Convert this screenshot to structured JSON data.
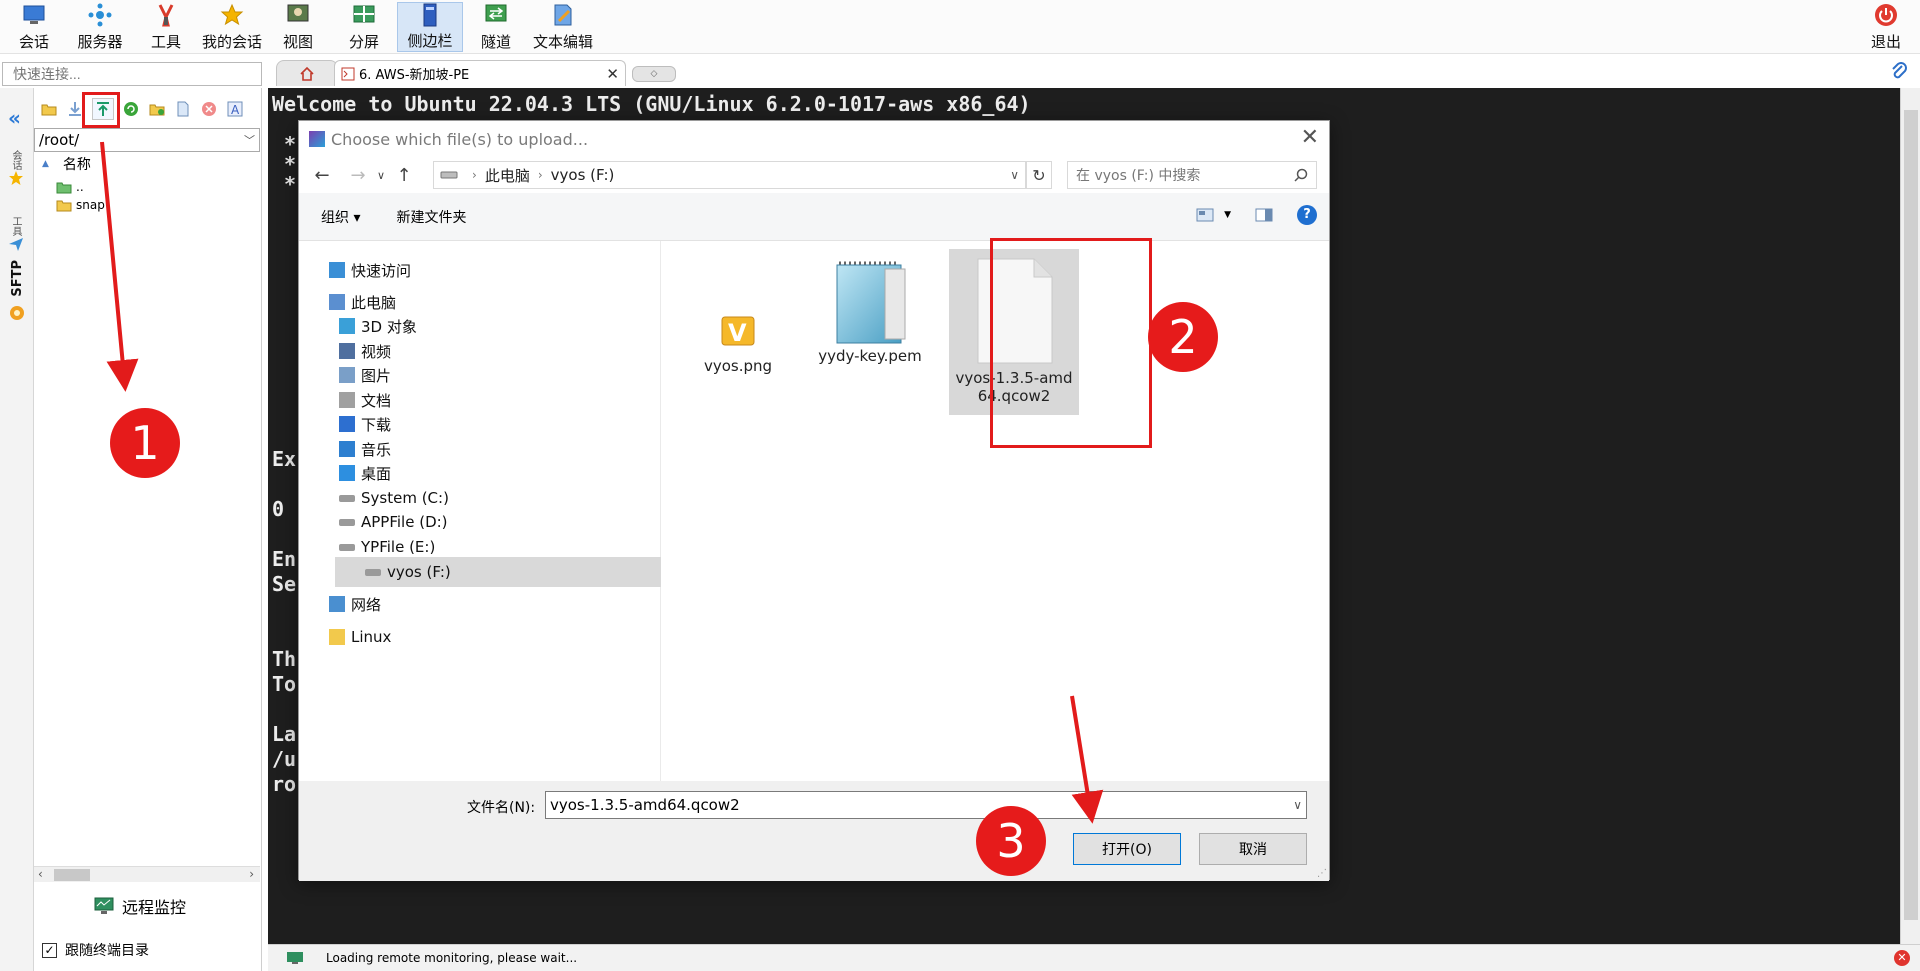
{
  "toolbar": {
    "items": [
      {
        "label": "会话",
        "icon": "session-icon"
      },
      {
        "label": "服务器",
        "icon": "server-icon"
      },
      {
        "label": "工具",
        "icon": "tools-icon"
      },
      {
        "label": "我的会话",
        "icon": "star-icon"
      },
      {
        "label": "视图",
        "icon": "view-icon"
      },
      {
        "label": "分屏",
        "icon": "split-icon"
      },
      {
        "label": "侧边栏",
        "icon": "sidebar-icon"
      },
      {
        "label": "隧道",
        "icon": "tunnel-icon"
      },
      {
        "label": "文本编辑",
        "icon": "text-edit-icon"
      }
    ],
    "exit_label": "退出"
  },
  "quick_connect": {
    "placeholder": "快速连接..."
  },
  "tabs": {
    "session_tab": "6. AWS-新加坡-PE"
  },
  "sftp": {
    "vertical_tab": "SFTP",
    "path": "/root/",
    "column_name": "名称",
    "entries": [
      {
        "name": ".."
      },
      {
        "name": "snap"
      }
    ],
    "remote_monitor": "远程监控",
    "follow_terminal": "跟随终端目录"
  },
  "terminal": {
    "lines": [
      {
        "text": "Welcome to Ubuntu 22.04.3 LTS (GNU/Linux 6.2.0-1017-aws x86_64)",
        "row": 0
      },
      {
        "text": " *",
        "row": 1.6
      },
      {
        "text": " *",
        "row": 2.4
      },
      {
        "text": " *",
        "row": 3.2
      },
      {
        "text": "Ex",
        "row": 14.2
      },
      {
        "text": "0",
        "row": 16.2
      },
      {
        "text": "En",
        "row": 18.2
      },
      {
        "text": "Se",
        "row": 19.2
      },
      {
        "text": "Th",
        "row": 22.2
      },
      {
        "text": "To",
        "row": 23.2
      },
      {
        "text": "La",
        "row": 25.2
      },
      {
        "text": "/u",
        "row": 26.2
      },
      {
        "text": "ro",
        "row": 27.2
      }
    ]
  },
  "status": {
    "text": "Loading remote monitoring, please wait..."
  },
  "dialog": {
    "title": "Choose which file(s) to upload...",
    "breadcrumb": [
      "此电脑",
      "vyos (F:)"
    ],
    "search_placeholder": "在 vyos (F:) 中搜索",
    "organize_label": "组织 ▾",
    "new_folder_label": "新建文件夹",
    "nav": [
      {
        "label": "快速访问",
        "icon": "star-icon"
      },
      {
        "label": "此电脑",
        "icon": "computer-icon"
      },
      {
        "label": "3D 对象",
        "icon": "cube-icon"
      },
      {
        "label": "视频",
        "icon": "video-icon"
      },
      {
        "label": "图片",
        "icon": "picture-icon"
      },
      {
        "label": "文档",
        "icon": "document-icon"
      },
      {
        "label": "下载",
        "icon": "download-icon"
      },
      {
        "label": "音乐",
        "icon": "music-icon"
      },
      {
        "label": "桌面",
        "icon": "desktop-icon"
      },
      {
        "label": "System (C:)",
        "icon": "drive-icon"
      },
      {
        "label": "APPFile (D:)",
        "icon": "drive-icon"
      },
      {
        "label": "YPFile (E:)",
        "icon": "drive-icon"
      },
      {
        "label": "vyos (F:)",
        "icon": "drive-icon",
        "selected": true
      },
      {
        "label": "网络",
        "icon": "network-icon"
      },
      {
        "label": "Linux",
        "icon": "folder-icon"
      }
    ],
    "files": [
      {
        "name": "vyos.png",
        "icon": "image-file-icon"
      },
      {
        "name": "yydy-key.pem",
        "icon": "notepad-file-icon"
      },
      {
        "name": "vyos-1.3.5-amd64.qcow2",
        "icon": "blank-file-icon",
        "selected": true
      }
    ],
    "filename_label": "文件名(N):",
    "filename_value": "vyos-1.3.5-amd64.qcow2",
    "open_label": "打开(O)",
    "cancel_label": "取消"
  },
  "annotations": {
    "step1": "1",
    "step2": "2",
    "step3": "3"
  },
  "colors": {
    "annotation_red": "#e21b1b",
    "terminal_bg": "#1e1e1e",
    "accent_blue": "#1f6fd0"
  }
}
